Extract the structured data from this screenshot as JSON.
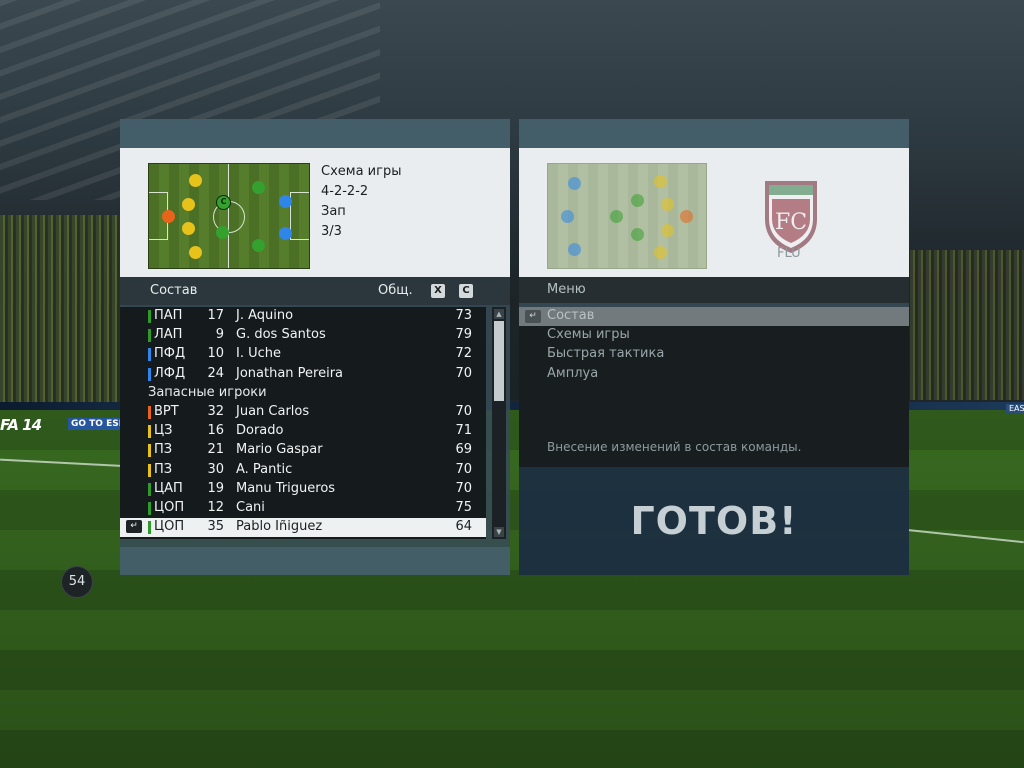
{
  "overlay": {
    "sub_count": "54"
  },
  "stadium_ads": {
    "left": "FA 14",
    "left2": "GO TO ESP",
    "right": "EAS"
  },
  "left_panel": {
    "formation_label": "Схема игры",
    "formation_value": "4-2-2-2",
    "subs_label": "Зап",
    "subs_value": "3/3",
    "captain_marker": "C",
    "list_header": "Состав",
    "overall_header": "Общ.",
    "key_x": "X",
    "key_c": "C",
    "enter_icon": "↵",
    "rows": [
      {
        "pos": "ПАП",
        "num": "17",
        "name": "J. Aquino",
        "ovr": "73",
        "color": "#2d9a2a"
      },
      {
        "pos": "ЛАП",
        "num": "9",
        "name": "G. dos Santos",
        "ovr": "79",
        "color": "#2d9a2a"
      },
      {
        "pos": "ПФД",
        "num": "10",
        "name": "I. Uche",
        "ovr": "72",
        "color": "#2f86e8"
      },
      {
        "pos": "ЛФД",
        "num": "24",
        "name": "Jonathan Pereira",
        "ovr": "70",
        "color": "#2f86e8"
      }
    ],
    "subs_section_label": "Запасные игроки",
    "sub_rows": [
      {
        "pos": "ВРТ",
        "num": "32",
        "name": "Juan Carlos",
        "ovr": "70",
        "color": "#e8641a"
      },
      {
        "pos": "ЦЗ",
        "num": "16",
        "name": "Dorado",
        "ovr": "71",
        "color": "#e7c21a"
      },
      {
        "pos": "ПЗ",
        "num": "21",
        "name": "Mario Gaspar",
        "ovr": "69",
        "color": "#e7c21a"
      },
      {
        "pos": "ПЗ",
        "num": "30",
        "name": "A. Pantic",
        "ovr": "70",
        "color": "#e7c21a"
      },
      {
        "pos": "ЦАП",
        "num": "19",
        "name": "Manu Trigueros",
        "ovr": "70",
        "color": "#2d9a2a"
      },
      {
        "pos": "ЦОП",
        "num": "12",
        "name": "Cani",
        "ovr": "75",
        "color": "#2d9a2a"
      },
      {
        "pos": "ЦОП",
        "num": "35",
        "name": "Pablo Iñiguez",
        "ovr": "64",
        "color": "#2d9a2a",
        "selected": true
      }
    ]
  },
  "right_panel": {
    "team_abbr": "FLU",
    "menu_header": "Меню",
    "enter_icon": "↵",
    "menu_items": [
      "Состав",
      "Схемы игры",
      "Быстрая тактика",
      "Амплуа"
    ],
    "description": "Внесение изменений в состав команды.",
    "ready_label": "ГОТОВ!"
  },
  "colors": {
    "gk": "#e8641a",
    "def": "#e7c21a",
    "mid": "#2d9a2a",
    "fwd": "#2f86e8"
  }
}
